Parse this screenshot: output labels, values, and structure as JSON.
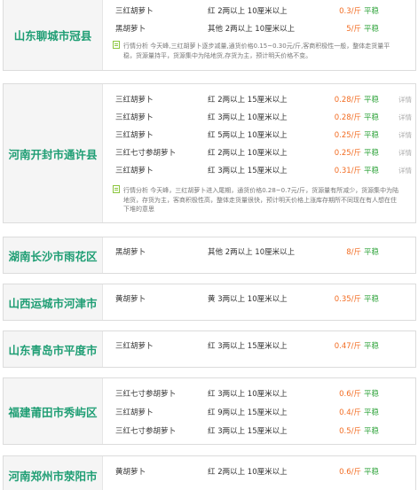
{
  "cards": [
    {
      "region": "山东聊城市冠县",
      "rows": [
        {
          "variety": "三红胡萝卜",
          "spec": "红 2两以上 10厘米以上",
          "price": "0.3/斤",
          "trend": "平稳",
          "detail": ""
        },
        {
          "variety": "黑胡萝卜",
          "spec": "其他 2两以上 10厘米以上",
          "price": "5/斤",
          "trend": "平稳",
          "detail": ""
        }
      ],
      "note": [
        "行情分析 今天峰,三红胡萝卜逐步减量,通货价格0.15~0.30元/斤,客商积极性一般，整体走货量平",
        "稳，货源量持平，货源集中为陆地货,存货为主，预计明天价格不变。"
      ]
    },
    {
      "region": "河南开封市通许县",
      "rows": [
        {
          "variety": "三红胡萝卜",
          "spec": "红 2两以上 15厘米以上",
          "price": "0.28/斤",
          "trend": "平稳",
          "detail": "详情"
        },
        {
          "variety": "三红胡萝卜",
          "spec": "红 3两以上 10厘米以上",
          "price": "0.28/斤",
          "trend": "平稳",
          "detail": "详情"
        },
        {
          "variety": "三红胡萝卜",
          "spec": "红 5两以上 10厘米以上",
          "price": "0.25/斤",
          "trend": "平稳",
          "detail": "详情"
        },
        {
          "variety": "三红七寸参胡萝卜",
          "spec": "红 2两以上 10厘米以上",
          "price": "0.25/斤",
          "trend": "平稳",
          "detail": "详情"
        },
        {
          "variety": "三红胡萝卜",
          "spec": "红 3两以上 15厘米以上",
          "price": "0.31/斤",
          "trend": "平稳",
          "detail": "详情"
        }
      ],
      "note": [
        "行情分析 今天峰，三红胡萝卜进入尾期，通货价格0.28~0.7元/斤，货源量有所减少，货源集中为陆",
        "地货，存货为主，客商积极性高，整体走货量很快，预计明天价格上涨库存期所不同现在有人想在住",
        "下堆的意思"
      ]
    },
    {
      "region": "湖南长沙市雨花区",
      "rows": [
        {
          "variety": "黑胡萝卜",
          "spec": "其他 2两以上 10厘米以上",
          "price": "8/斤",
          "trend": "平稳",
          "detail": ""
        }
      ],
      "note": []
    },
    {
      "region": "山西运城市河津市",
      "rows": [
        {
          "variety": "黄胡萝卜",
          "spec": "黄 3两以上 10厘米以上",
          "price": "0.35/斤",
          "trend": "平稳",
          "detail": ""
        }
      ],
      "note": []
    },
    {
      "region": "山东青岛市平度市",
      "rows": [
        {
          "variety": "三红胡萝卜",
          "spec": "红 3两以上 15厘米以上",
          "price": "0.47/斤",
          "trend": "平稳",
          "detail": ""
        }
      ],
      "note": []
    },
    {
      "region": "福建莆田市秀屿区",
      "rows": [
        {
          "variety": "三红七寸参胡萝卜",
          "spec": "红 3两以上 10厘米以上",
          "price": "0.6/斤",
          "trend": "平稳",
          "detail": ""
        },
        {
          "variety": "三红胡萝卜",
          "spec": "红 9两以上 15厘米以上",
          "price": "0.4/斤",
          "trend": "平稳",
          "detail": ""
        },
        {
          "variety": "三红七寸参胡萝卜",
          "spec": "红 3两以上 15厘米以上",
          "price": "0.5/斤",
          "trend": "平稳",
          "detail": ""
        }
      ],
      "note": []
    },
    {
      "region": "河南郑州市荥阳市",
      "rows": [
        {
          "variety": "黄胡萝卜",
          "spec": "红 2两以上 10厘米以上",
          "price": "0.6/斤",
          "trend": "平稳",
          "detail": ""
        }
      ],
      "note": []
    }
  ]
}
